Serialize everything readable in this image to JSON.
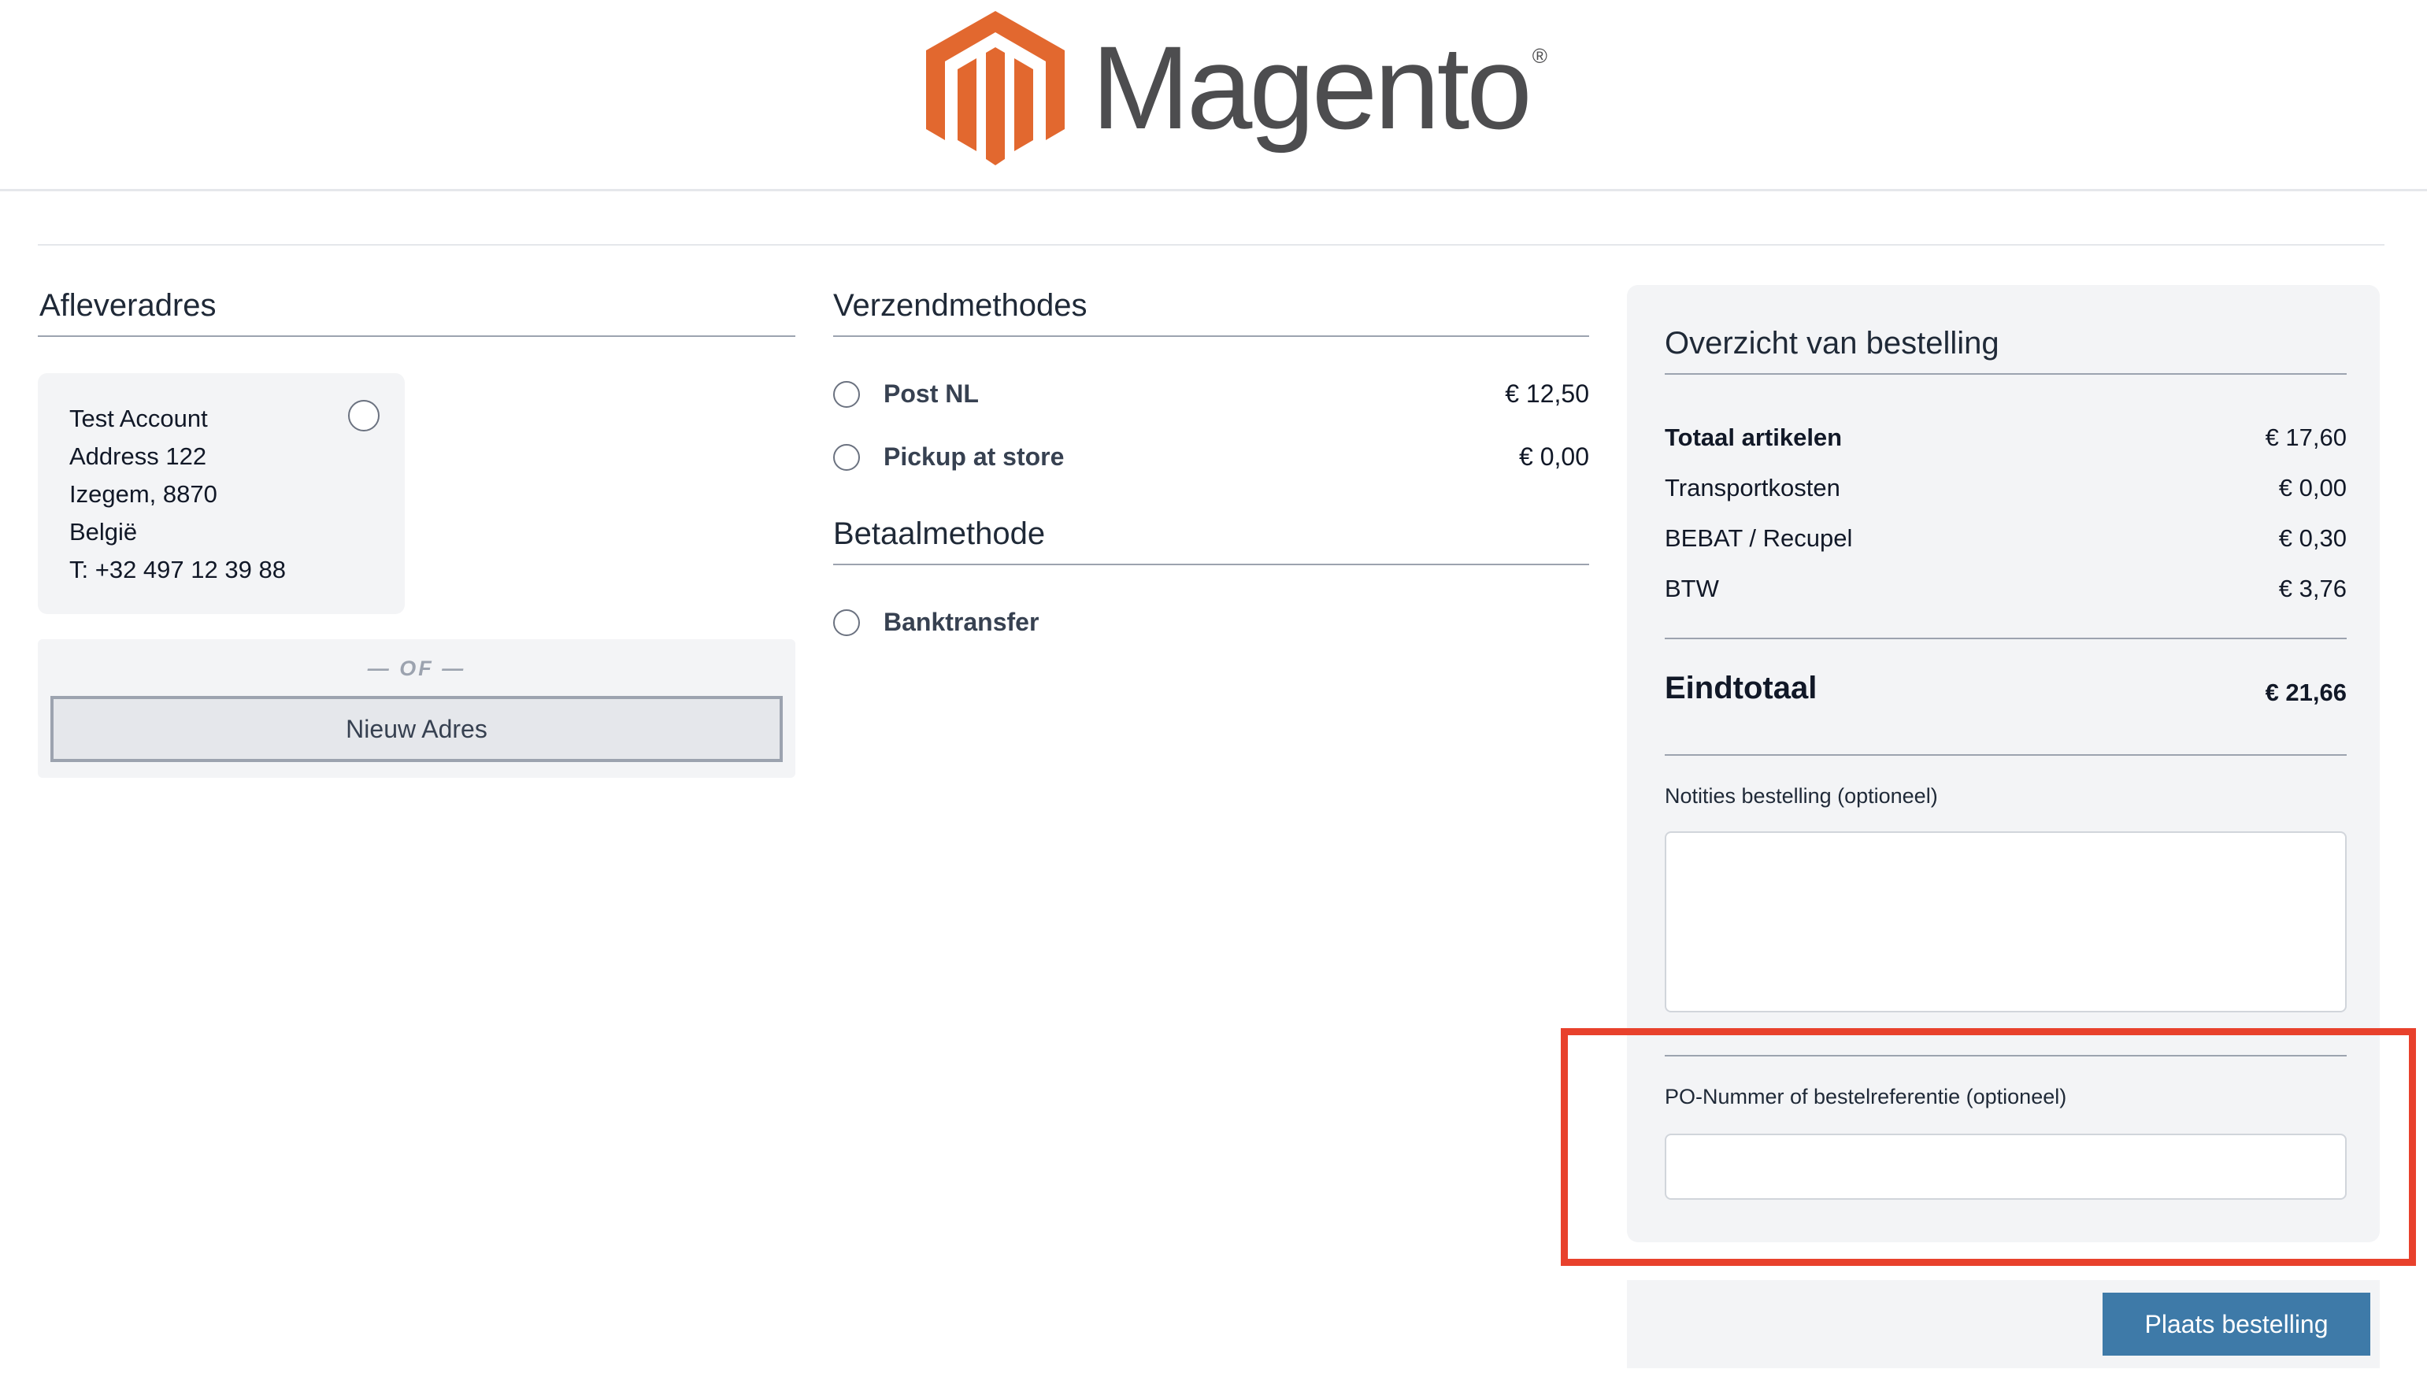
{
  "header": {
    "brand": "Magento",
    "trademark": "®",
    "logo_icon": "magento-logo-icon",
    "logo_color": "#e2682f"
  },
  "shipping_address": {
    "title": "Afleveradres",
    "card": {
      "lines": [
        "Test Account",
        "Address 122",
        "Izegem, 8870",
        "België",
        "T: +32 497 12 39 88"
      ],
      "selected": false
    },
    "or_label": "— OF —",
    "new_address_button": "Nieuw Adres"
  },
  "shipping_methods": {
    "title": "Verzendmethodes",
    "options": [
      {
        "label": "Post NL",
        "price": "€ 12,50",
        "selected": false
      },
      {
        "label": "Pickup at store",
        "price": "€ 0,00",
        "selected": false
      }
    ]
  },
  "payment": {
    "title": "Betaalmethode",
    "options": [
      {
        "label": "Banktransfer",
        "selected": false
      }
    ]
  },
  "summary": {
    "title": "Overzicht van bestelling",
    "rows": [
      {
        "label": "Totaal artikelen",
        "value": "€ 17,60"
      },
      {
        "label": "Transportkosten",
        "value": "€ 0,00"
      },
      {
        "label": "BEBAT / Recupel",
        "value": "€ 0,30"
      },
      {
        "label": "BTW",
        "value": "€ 3,76"
      }
    ],
    "grand_total": {
      "label": "Eindtotaal",
      "value": "€ 21,66"
    },
    "notes_label": "Notities bestelling (optioneel)",
    "notes_value": "",
    "po_label": "PO-Nummer of bestelreferentie (optioneel)",
    "po_value": ""
  },
  "place_order_button": "Plaats bestelling",
  "colors": {
    "accent": "#3e7aa8",
    "highlight": "#e8412c",
    "panel": "#f3f4f6"
  }
}
